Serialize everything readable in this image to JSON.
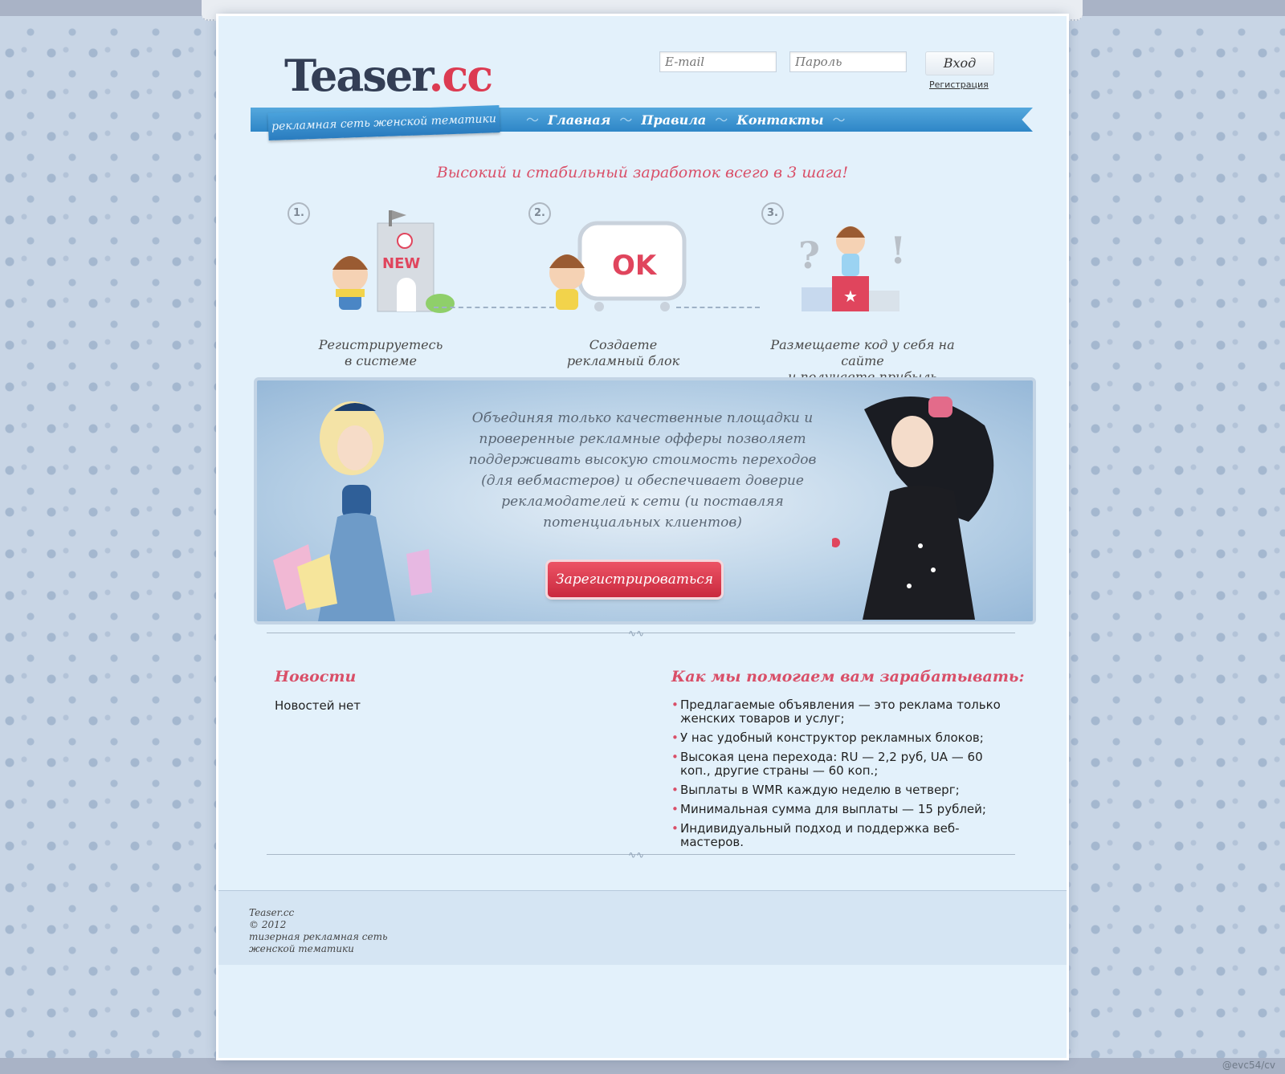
{
  "site": {
    "logo": "Teaser",
    "logo_dot": ".cc"
  },
  "login": {
    "email_placeholder": "E-mail",
    "password_placeholder": "Пароль",
    "submit": "Вход",
    "register_link": "Регистрация"
  },
  "ribbon": {
    "tagline": "рекламная сеть женской тематики"
  },
  "nav": [
    {
      "label": "Главная"
    },
    {
      "label": "Правила"
    },
    {
      "label": "Контакты"
    }
  ],
  "headline": "Высокий и стабильный заработок всего в 3 шага!",
  "steps": [
    {
      "num": "1.",
      "caption": "Регистрируетесь\nв системе"
    },
    {
      "num": "2.",
      "caption": "Создаете\nрекламный блок"
    },
    {
      "num": "3.",
      "caption": "Размещаете код у себя на сайте\nи получаете прибыль"
    }
  ],
  "banner": {
    "text": "Объединяя только качественные площадки и проверенные рекламные офферы позволяет поддерживать высокую стоимость переходов (для вебмастеров) и обеспечивает доверие рекламодателей к сети (и поставляя потенциальных клиентов)",
    "button": "Зарегистрироваться"
  },
  "news": {
    "title": "Новости",
    "empty": "Новостей нет"
  },
  "help": {
    "title": "Как мы помогаем вам зарабатывать:",
    "items": [
      "Предлагаемые объявления — это реклама только женских товаров и услуг;",
      "У нас удобный конструктор рекламных блоков;",
      "Высокая цена перехода: RU — 2,2 руб, UA — 60 коп., другие страны — 60 коп.;",
      "Выплаты в WMR каждую неделю в четверг;",
      "Минимальная сумма для выплаты — 15 рублей;",
      "Индивидуальный подход и поддержка веб-мастеров."
    ]
  },
  "footer": {
    "name": "Teaser.cc",
    "copyright": "© 2012",
    "desc_line1": "тизерная рекламная сеть",
    "desc_line2": "женской тематики"
  },
  "watermark": "@evc54/cv",
  "colors": {
    "accent": "#d94f68",
    "nav_blue": "#2e86c7",
    "page_bg": "#e3f1fb"
  }
}
